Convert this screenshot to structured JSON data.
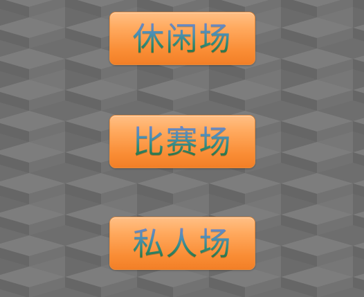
{
  "menu": {
    "buttons": [
      {
        "label": "休闲场"
      },
      {
        "label": "比赛场"
      },
      {
        "label": "私人场"
      }
    ]
  },
  "colors": {
    "background": "#6f6f6f",
    "button_top": "#ffbf85",
    "button_bottom": "#f27f27",
    "label_top": "#6f86c6",
    "label_bottom": "#2e6e3a"
  }
}
